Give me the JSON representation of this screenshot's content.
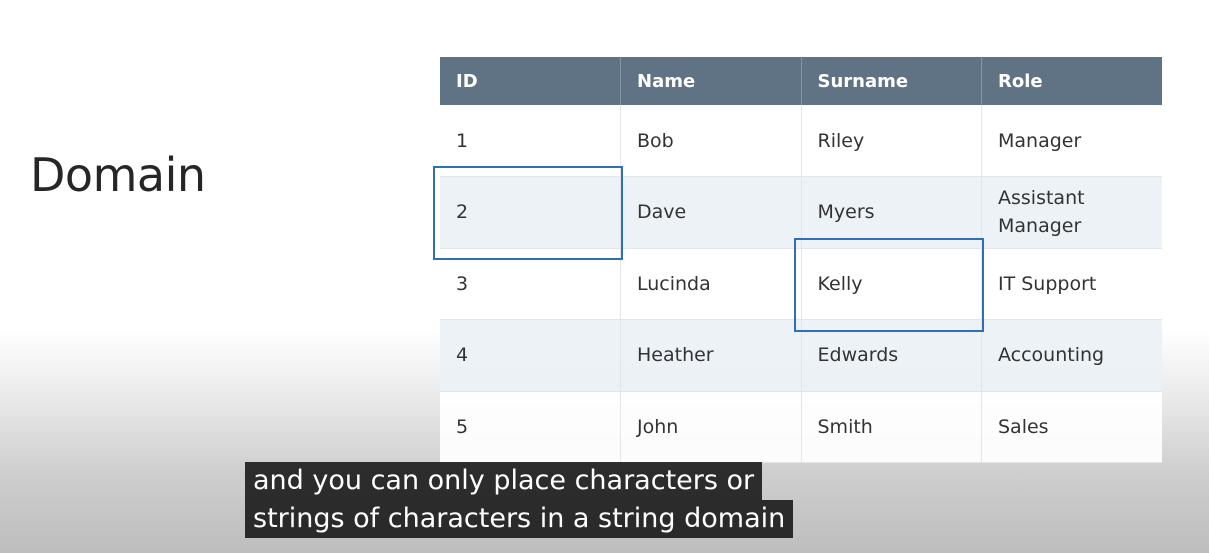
{
  "slide": {
    "title": "Domain"
  },
  "table": {
    "headers": [
      "ID",
      "Name",
      "Surname",
      "Role"
    ],
    "rows": [
      [
        "1",
        "Bob",
        "Riley",
        "Manager"
      ],
      [
        "2",
        "Dave",
        "Myers",
        "Assistant Manager"
      ],
      [
        "3",
        "Lucinda",
        "Kelly",
        "IT Support"
      ],
      [
        "4",
        "Heather",
        "Edwards",
        "Accounting"
      ],
      [
        "5",
        "John",
        "Smith",
        "Sales"
      ]
    ],
    "header_color": "#5f7384",
    "highlight_color": "#2f6fba",
    "highlighted_cells": [
      "2",
      "Kelly"
    ]
  },
  "caption": {
    "lines": [
      "and you can only place characters or",
      "strings of characters in a string domain"
    ]
  }
}
